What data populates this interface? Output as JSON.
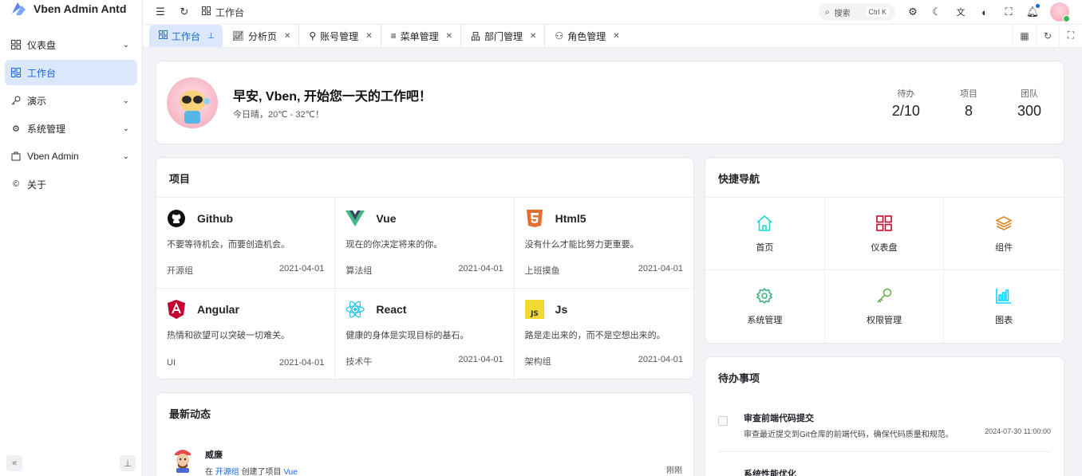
{
  "app": {
    "title": "Vben Admin Antd"
  },
  "sidebar": {
    "items": [
      {
        "label": "仪表盘",
        "icon": "dashboard-icon",
        "expandable": true
      },
      {
        "label": "工作台",
        "icon": "workspace-icon",
        "active": true
      },
      {
        "label": "演示",
        "icon": "key-icon",
        "expandable": true
      },
      {
        "label": "系统管理",
        "icon": "gear-icon",
        "expandable": true
      },
      {
        "label": "Vben Admin",
        "icon": "vben-icon",
        "expandable": true
      },
      {
        "label": "关于",
        "icon": "copyright-icon"
      }
    ]
  },
  "header": {
    "breadcrumb": "工作台",
    "search_label": "搜索",
    "search_shortcut": "Ctrl K"
  },
  "tabs": [
    {
      "label": "工作台",
      "icon": "workspace-icon",
      "active": true,
      "pinned": true
    },
    {
      "label": "分析页",
      "icon": "chart-line-icon"
    },
    {
      "label": "账号管理",
      "icon": "user-icon"
    },
    {
      "label": "菜单管理",
      "icon": "menu-icon"
    },
    {
      "label": "部门管理",
      "icon": "org-icon"
    },
    {
      "label": "角色管理",
      "icon": "users-icon"
    }
  ],
  "welcome": {
    "title": "早安, Vben, 开始您一天的工作吧！",
    "subtitle": "今日晴，20℃ - 32℃！",
    "stats": [
      {
        "label": "待办",
        "value": "2/10"
      },
      {
        "label": "项目",
        "value": "8"
      },
      {
        "label": "团队",
        "value": "300"
      }
    ]
  },
  "projects": {
    "title": "项目",
    "items": [
      {
        "name": "Github",
        "icon": "github-icon",
        "desc": "不要等待机会，而要创造机会。",
        "group": "开源组",
        "date": "2021-04-01",
        "color": "#111111"
      },
      {
        "name": "Vue",
        "icon": "vue-icon",
        "desc": "现在的你决定将来的你。",
        "group": "算法组",
        "date": "2021-04-01",
        "color": "#42b883"
      },
      {
        "name": "Html5",
        "icon": "html5-icon",
        "desc": "没有什么才能比努力更重要。",
        "group": "上班摸鱼",
        "date": "2021-04-01",
        "color": "#e36e30"
      },
      {
        "name": "Angular",
        "icon": "angular-icon",
        "desc": "热情和欲望可以突破一切难关。",
        "group": "UI",
        "date": "2021-04-01",
        "color": "#c3002f"
      },
      {
        "name": "React",
        "icon": "react-icon",
        "desc": "健康的身体是实现目标的基石。",
        "group": "技术牛",
        "date": "2021-04-01",
        "color": "#2fc3e6"
      },
      {
        "name": "Js",
        "icon": "js-icon",
        "desc": "路是走出来的，而不是空想出来的。",
        "group": "架构组",
        "date": "2021-04-01",
        "color": "#f1d832"
      }
    ]
  },
  "quicknav": {
    "title": "快捷导航",
    "items": [
      {
        "label": "首页",
        "icon": "home-icon",
        "color": "#1fdaca"
      },
      {
        "label": "仪表盘",
        "icon": "dashboard-icon",
        "color": "#bf0c2c"
      },
      {
        "label": "组件",
        "icon": "layers-icon",
        "color": "#e18525"
      },
      {
        "label": "系统管理",
        "icon": "gear-icon",
        "color": "#3fb27f"
      },
      {
        "label": "权限管理",
        "icon": "key-icon",
        "color": "#4daf1bc9"
      },
      {
        "label": "图表",
        "icon": "bar-chart-icon",
        "color": "#00d8ff"
      }
    ]
  },
  "todo": {
    "title": "待办事项",
    "items": [
      {
        "title": "审查前端代码提交",
        "desc": "审查最近提交到Git仓库的前端代码，确保代码质量和规范。",
        "time": "2024-07-30 11:00:00"
      },
      {
        "title": "系统性能优化"
      }
    ]
  },
  "activity": {
    "title": "最新动态",
    "items": [
      {
        "name": "威廉",
        "prefix": "在",
        "link": "开源组",
        "middle": "创建了项目",
        "target": "Vue",
        "time": "刚刚"
      }
    ]
  },
  "colors": {
    "accent": "#1a67e0",
    "active_bg": "#dbe7fb"
  }
}
